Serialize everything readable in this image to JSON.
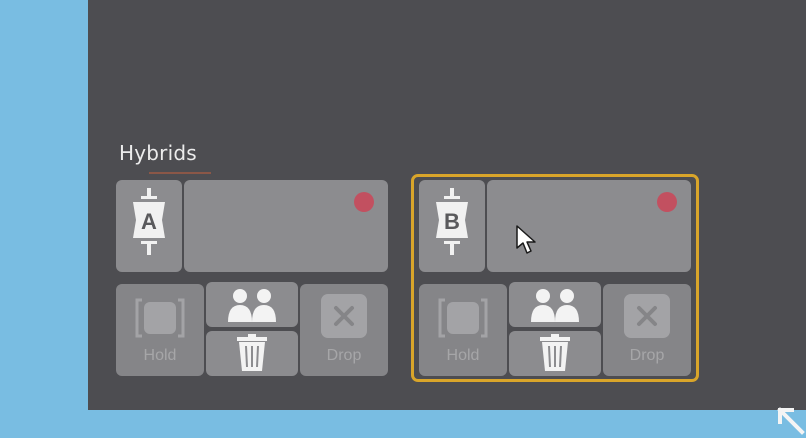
{
  "section": {
    "title": "Hybrids"
  },
  "decks": [
    {
      "letter": "A",
      "selected": false,
      "hold_label": "Hold",
      "drop_label": "Drop",
      "icons": [
        "deck-a-icon",
        "hold-icon",
        "users-icon",
        "trash-icon",
        "drop-x-icon"
      ]
    },
    {
      "letter": "B",
      "selected": true,
      "hold_label": "Hold",
      "drop_label": "Drop",
      "icons": [
        "deck-b-icon",
        "hold-icon",
        "users-icon",
        "trash-icon",
        "drop-x-icon"
      ]
    }
  ],
  "colors": {
    "background": "#79bde2",
    "panel": "#4d4d51",
    "tile": "#8c8c8f",
    "selection_border": "#d9a52a",
    "record_dot": "#c25060"
  }
}
